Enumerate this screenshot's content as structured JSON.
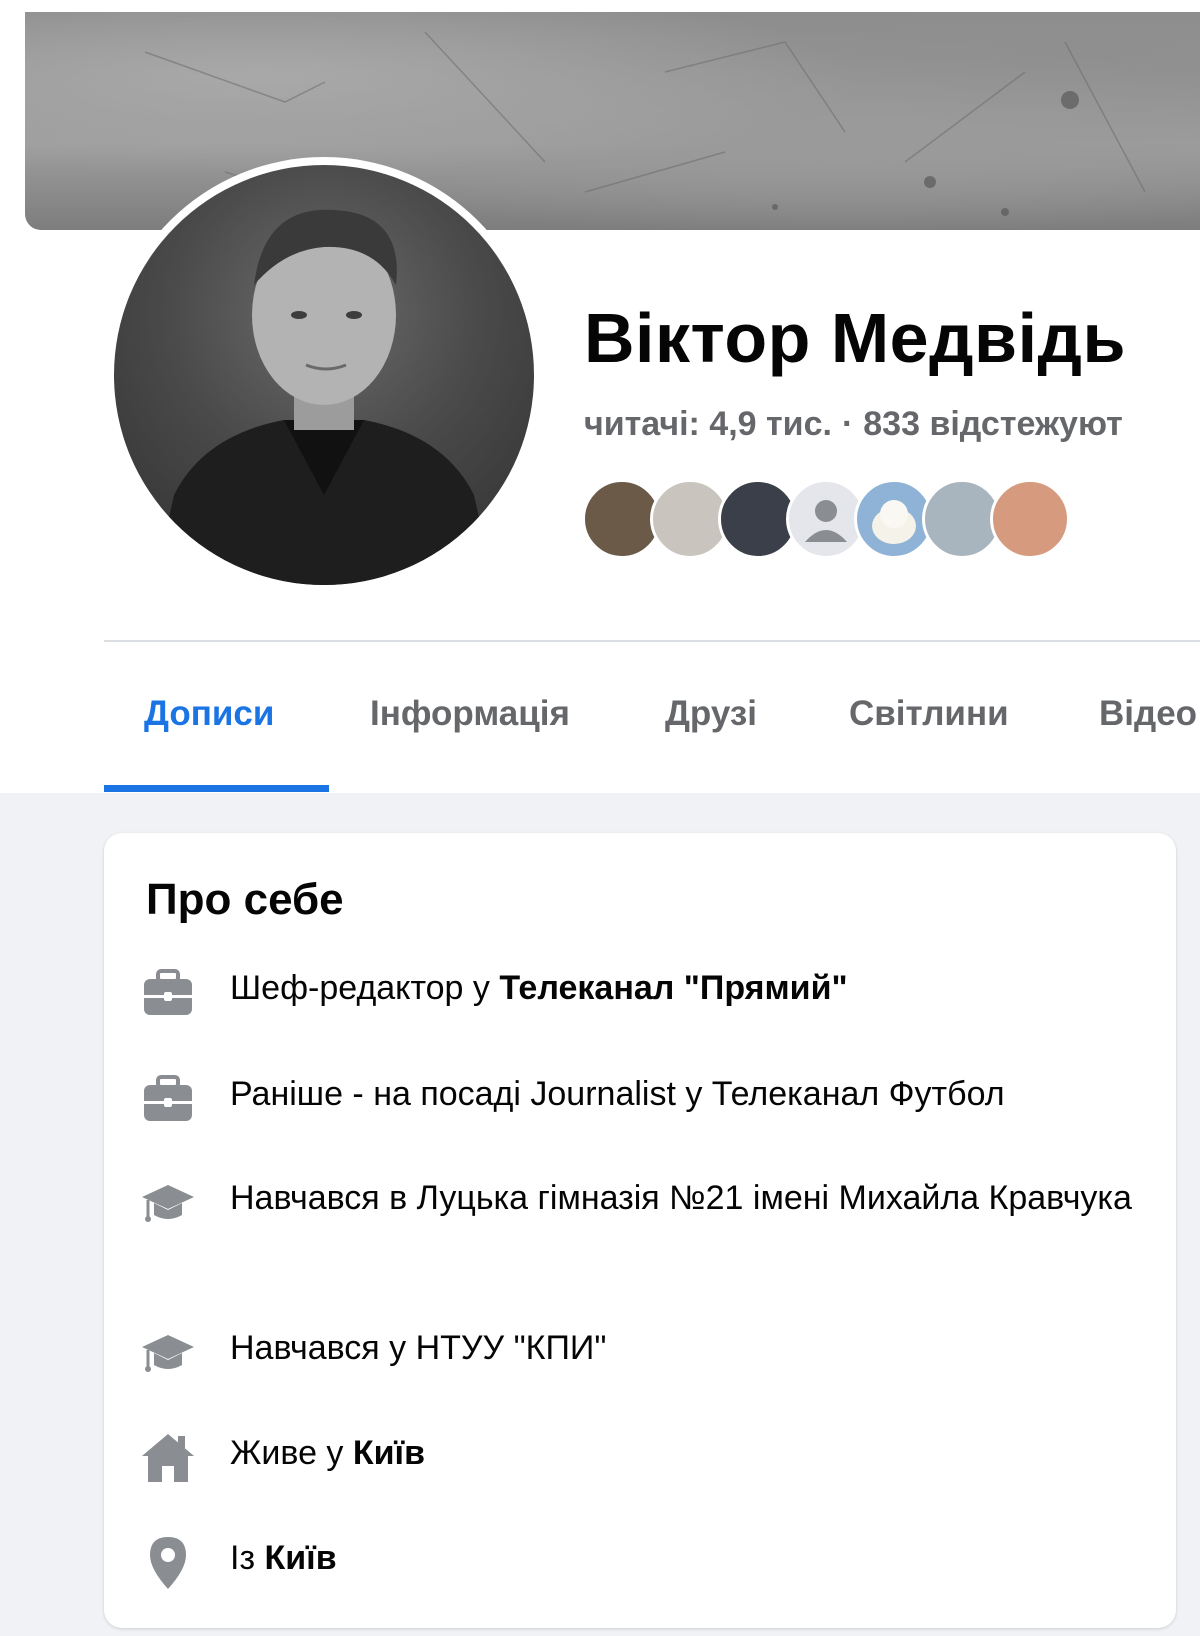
{
  "profile": {
    "name": "Віктор Медвідь",
    "followers": "читачі: 4,9 тис.",
    "separator": "·",
    "following": "833 відстежуют"
  },
  "friends": {
    "avatars": [
      {
        "icon": "friend-avatar-1",
        "color": "#6b5a48"
      },
      {
        "icon": "friend-avatar-2",
        "color": "#c9c4bd"
      },
      {
        "icon": "friend-avatar-3",
        "color": "#3a3f4a"
      },
      {
        "icon": "default-person-icon",
        "color": "#e4e6eb"
      },
      {
        "icon": "friend-avatar-5",
        "color": "#8fb3d6"
      },
      {
        "icon": "friend-avatar-6",
        "color": "#a8b5bf"
      },
      {
        "icon": "friend-avatar-7",
        "color": "#d69a7e"
      }
    ]
  },
  "tabs": [
    {
      "label": "Дописи",
      "active": true
    },
    {
      "label": "Інформація",
      "active": false
    },
    {
      "label": "Друзі",
      "active": false
    },
    {
      "label": "Світлини",
      "active": false
    },
    {
      "label": "Відео",
      "active": false
    }
  ],
  "about": {
    "title": "Про себе",
    "items": [
      {
        "icon": "briefcase-icon",
        "prefix": "Шеф-редактор у ",
        "strong": "Телеканал \"Прямий\""
      },
      {
        "icon": "briefcase-icon",
        "prefix": "Раніше - на посаді Journalist у Телеканал Футбол",
        "strong": ""
      },
      {
        "icon": "graduation-cap-icon",
        "prefix": "Навчався в Луцька гімназія №21 імені Михайла Кравчука",
        "strong": ""
      },
      {
        "icon": "graduation-cap-icon",
        "prefix": "Навчався у НТУУ \"КПИ\"",
        "strong": ""
      },
      {
        "icon": "home-icon",
        "prefix": "Живе у ",
        "strong": "Київ"
      },
      {
        "icon": "location-pin-icon",
        "prefix": "Із ",
        "strong": "Київ"
      }
    ]
  },
  "colors": {
    "accent": "#1b74e4",
    "secondary_text": "#65676b",
    "icon_gray": "#8a8d91",
    "page_bg": "#f0f2f5"
  }
}
